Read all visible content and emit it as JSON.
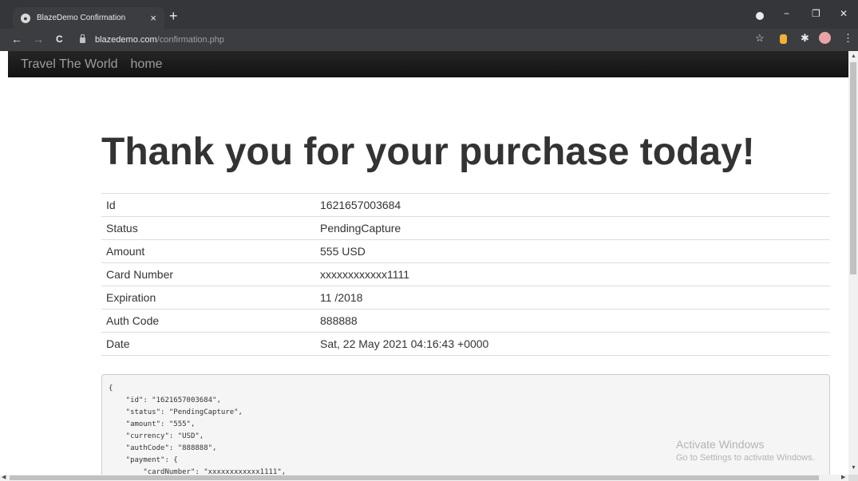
{
  "browser": {
    "tab_title": "BlazeDemo Confirmation",
    "tab_close": "×",
    "new_tab": "+",
    "url_host": "blazedemo.com",
    "url_path": "/confirmation.php",
    "back_icon": "←",
    "forward_icon": "→",
    "reload_icon": "C",
    "minimize_icon": "−",
    "restore_icon": "❐",
    "close_icon": "✕",
    "star_icon": "☆",
    "extension_icon": "✱",
    "menu_icon": "⋮"
  },
  "navbar": {
    "brand": "Travel The World",
    "home": "home"
  },
  "page": {
    "heading": "Thank you for your purchase today!"
  },
  "details": [
    {
      "label": "Id",
      "value": "1621657003684"
    },
    {
      "label": "Status",
      "value": "PendingCapture"
    },
    {
      "label": "Amount",
      "value": "555 USD"
    },
    {
      "label": "Card Number",
      "value": "xxxxxxxxxxxx1111"
    },
    {
      "label": "Expiration",
      "value": "11 /2018"
    },
    {
      "label": "Auth Code",
      "value": "888888"
    },
    {
      "label": "Date",
      "value": "Sat, 22 May 2021 04:16:43 +0000"
    }
  ],
  "json_block": "{\n    \"id\": \"1621657003684\",\n    \"status\": \"PendingCapture\",\n    \"amount\": \"555\",\n    \"currency\": \"USD\",\n    \"authCode\": \"888888\",\n    \"payment\": {\n        \"cardNumber\": \"xxxxxxxxxxxx1111\",",
  "watermark": {
    "title": "Activate Windows",
    "subtitle": "Go to Settings to activate Windows."
  },
  "colors": {
    "chrome_dark": "#35363a",
    "chrome_toolbar": "#3c3d41",
    "navbar": "#1b1b1b",
    "text": "#333333"
  }
}
